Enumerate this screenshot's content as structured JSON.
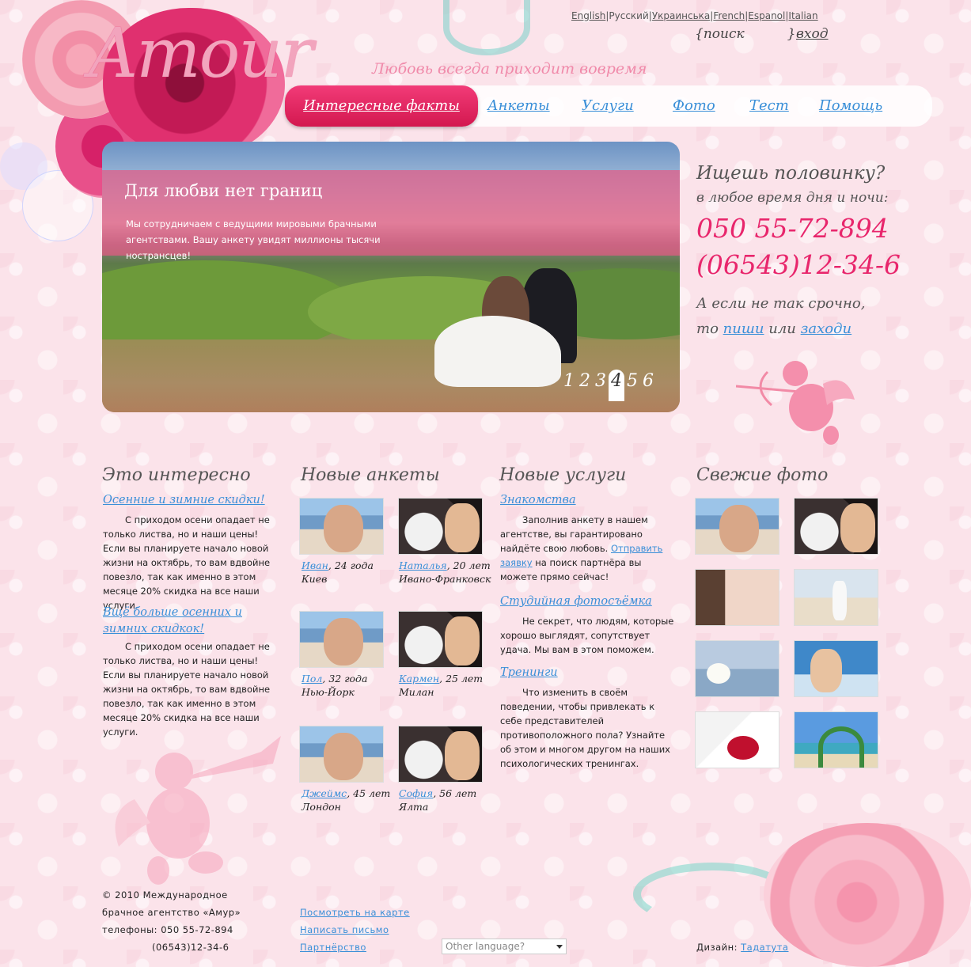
{
  "header": {
    "logo": "Amour",
    "tagline": "Любовь всегда приходит вовремя",
    "languages": [
      "English",
      "Русский",
      "Украинська",
      "French",
      "Espanol",
      "Italian"
    ],
    "search_label": "{поиск          }",
    "login_label": "вход"
  },
  "nav": {
    "items": [
      {
        "label": "Интересные факты",
        "active": true
      },
      {
        "label": "Анкеты"
      },
      {
        "label": "Услуги"
      },
      {
        "label": "Фото"
      },
      {
        "label": "Тест"
      },
      {
        "label": "Помощь"
      }
    ]
  },
  "slider": {
    "title": "Для любви нет границ",
    "text": "Мы сотрудничаем с ведущими мировыми брачными агентствами. Вашу анкету увидят миллионы тысячи нострансцев!",
    "pages": [
      "1",
      "2",
      "3",
      "4",
      "5",
      "6"
    ],
    "current_page": "4"
  },
  "contact": {
    "title": "Ищешь половинку?",
    "subtitle": "в любое время дня и ночи:",
    "phone1": "050 55-72-894",
    "phone2": "(06543)12-34-6",
    "alt_line1": "А если не так срочно,",
    "alt_to": "то",
    "alt_write": "пиши",
    "alt_or": "или",
    "alt_visit": "заходи"
  },
  "interesting": {
    "title": "Это интересно",
    "items": [
      {
        "link": "Осенние и зимние скидки!",
        "text": "С приходом осени опадает не только листва, но и наши цены! Если вы планируете начало новой жизни на октябрь, то вам вдвойне повезло, так как именно в этом месяце 20% скидка на все наши услуги."
      },
      {
        "link": "Вщё больше осенних и зимних скидкок!",
        "text": "С приходом осени опадает не только листва, но и наши цены! Если вы планируете начало новой жизни на октябрь, то вам вдвойне повезло, так как именно в этом месяце 20% скидка на все наши услуги."
      }
    ]
  },
  "profiles": {
    "title": "Новые анкеты",
    "items": [
      {
        "name": "Иван",
        "age": ", 24 года",
        "city": "Киев"
      },
      {
        "name": "Наталья",
        "age": ", 20 лет",
        "city": "Ивано-Франковск"
      },
      {
        "name": "Пол",
        "age": ", 32 года",
        "city": "Нью-Йорк"
      },
      {
        "name": "Кармен",
        "age": ", 25 лет",
        "city": "Милан"
      },
      {
        "name": "Джеймс",
        "age": ", 45 лет",
        "city": "Лондон"
      },
      {
        "name": "София",
        "age": ", 56 лет",
        "city": "Ялта"
      }
    ]
  },
  "services": {
    "title": "Новые услуги",
    "items": [
      {
        "link": "Знакомства",
        "text": "Заполнив анкету в нашем агентстве, вы гарантировано найдёте свою любовь.",
        "request_link": "Отправить заявку",
        "request_text": " на поиск партнёра вы можете прямо сейчас!"
      },
      {
        "link": "Студийная фотосъёмка",
        "text": "Не секрет, что людям, которые хорошо выглядят, сопутствует удача. Мы вам в этом поможем."
      },
      {
        "link": "Тренинги",
        "text": "Что изменить в своём поведении, чтобы привлекать к себе представителей противоположного пола? Узнайте об этом и многом другом на наших психологических тренингах."
      }
    ]
  },
  "photos": {
    "title": "Свежие фото"
  },
  "footer": {
    "copyright_line1": "© 2010  Международное",
    "copyright_line2": "брачное агентство «Амур»",
    "phones_line": "телефоны: 050 55-72-894",
    "phone2": "(06543)12-34-6",
    "map_link": "Посмотреть на карте",
    "mail_link": "Написать письмо",
    "partner_link": "Партнёрство",
    "language_select": "Other language?",
    "design_label": "Дизайн: ",
    "design_link": "Тадатута"
  },
  "colors": {
    "accent": "#e8266c",
    "link": "#3a8fd8",
    "background": "#fbe3ea"
  }
}
